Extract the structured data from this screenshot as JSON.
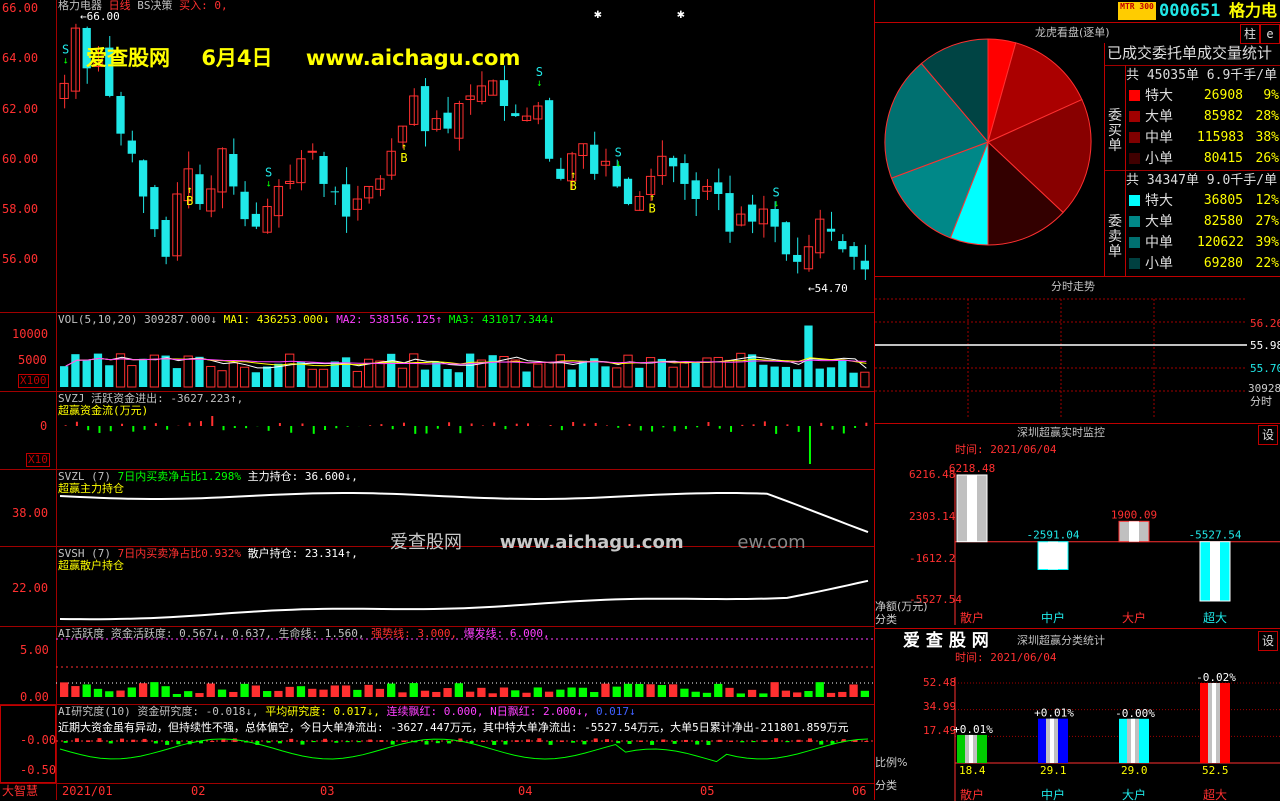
{
  "colors": {
    "up": "#ff3030",
    "down": "#20e8e8",
    "grid": "#a00000",
    "white": "#ffffff",
    "yellow": "#ffff00",
    "magenta": "#ff40ff",
    "green": "#00ff00"
  },
  "main": {
    "header": {
      "name": "格力电器",
      "period": "日线",
      "strategy": "BS决策",
      "buy": "买入: 0,"
    },
    "yaxis": [
      "66.00",
      "64.00",
      "62.00",
      "60.00",
      "58.00",
      "56.00"
    ],
    "max_label": "66.00",
    "min_label": "54.70",
    "watermark": {
      "site": "爱查股网",
      "date": "6月4日",
      "url": "www.aichagu.com"
    }
  },
  "vol": {
    "label": "VOL(5,10,20)",
    "value": "309287.000↓",
    "ma1": "MA1: 436253.000↓",
    "ma2": "MA2: 538156.125↑",
    "ma3": "MA3: 431017.344↓",
    "yaxis": [
      "10000",
      "5000"
    ],
    "unit": "X100"
  },
  "svzj": {
    "label": "SVZJ",
    "desc": "活跃资金进出: -3627.223↑,",
    "sub": "超赢资金流(万元)",
    "yaxis": [
      "0"
    ],
    "unit": "X10"
  },
  "svzl": {
    "label": "SVZL (7)",
    "desc": "7日内买卖净占比1.298%",
    "hold": "主力持仓: 36.600↓,",
    "sub": "超赢主力持仓",
    "yaxis": [
      "38.00"
    ],
    "overlay": {
      "site": "爱查股网",
      "url": "www.aichagu.com",
      "tail": "ew.com"
    }
  },
  "svsh": {
    "label": "SVSH (7)",
    "desc": "7日内买卖净占比0.932%",
    "hold": "散户持仓: 23.314↑,",
    "sub": "超赢散户持仓",
    "yaxis": [
      "22.00"
    ]
  },
  "ai": {
    "label": "AI活跃度",
    "a": "资金活跃度: 0.567↓, 0.637, 生命线: 1.560,",
    "strong": "强势线: 3.000,",
    "burst": "爆发线: 6.000,",
    "yaxis": [
      "5.00",
      "0.00"
    ]
  },
  "air": {
    "label": "AI研究度(10)",
    "a": "资金研究度: -0.018↓,",
    "b": "平均研究度: 0.017↓,",
    "c": "连续飘红: 0.000,",
    "d": "N日飘红: 2.000↓,",
    "e": "0.017↓",
    "note": "近期大资金虽有异动，但持续性不强，总体偏空，今日大单净流出: -3627.447万元，其中特大单净流出: -5527.54万元，大单5日累计净出-211801.859万元",
    "yaxis": [
      "-0.00",
      "-0.50"
    ]
  },
  "xaxis": {
    "app": "大智慧",
    "labels": [
      "2021/01",
      "02",
      "03",
      "04",
      "05",
      "06"
    ]
  },
  "right": {
    "badge": "MTR 300",
    "code": "000651",
    "name": "格力电",
    "btn_zhu": "柱",
    "btn_e": "e",
    "pie": {
      "title": "龙虎看盘(逐单)",
      "header": "已成交委托单成交量统计",
      "buy": {
        "side": "委买单",
        "total": "共 45035单 6.9千手/单",
        "rows": [
          {
            "k": "特大",
            "v": "26908",
            "p": "9%",
            "c": "#ff0000"
          },
          {
            "k": "大单",
            "v": "85982",
            "p": "28%",
            "c": "#a00000"
          },
          {
            "k": "中单",
            "v": "115983",
            "p": "38%",
            "c": "#800000"
          },
          {
            "k": "小单",
            "v": "80415",
            "p": "26%",
            "c": "#400000"
          }
        ]
      },
      "sell": {
        "side": "委卖单",
        "total": "共 34347单 9.0千手/单",
        "rows": [
          {
            "k": "特大",
            "v": "36805",
            "p": "12%",
            "c": "#00ffff"
          },
          {
            "k": "大单",
            "v": "82580",
            "p": "27%",
            "c": "#008888"
          },
          {
            "k": "中单",
            "v": "120622",
            "p": "39%",
            "c": "#007070"
          },
          {
            "k": "小单",
            "v": "69280",
            "p": "22%",
            "c": "#004040"
          }
        ]
      }
    },
    "intraday": {
      "title": "分时走势",
      "labels": [
        "56.26",
        "55.98",
        "55.70",
        "30928"
      ],
      "unit": "分时"
    },
    "monitor": {
      "title": "深圳超赢实时监控",
      "btn": "设",
      "time": "时间: 2021/06/04",
      "yaxis": [
        "6216.48",
        "2303.14",
        "-1612.2",
        "-5527.54"
      ],
      "unit": "净额(万元)",
      "cat_label": "分类",
      "bars": [
        {
          "cat": "散户",
          "value": 6218.48,
          "label": "6218.48"
        },
        {
          "cat": "中户",
          "value": -2591.04,
          "label": "-2591.04"
        },
        {
          "cat": "大户",
          "value": 1900.09,
          "label": "1900.09"
        },
        {
          "cat": "超大",
          "value": -5527.54,
          "label": "-5527.54"
        }
      ]
    },
    "stats": {
      "brand": "爱 查 股 网",
      "title": "深圳超赢分类统计",
      "btn": "设",
      "time": "时间: 2021/06/04",
      "yaxis": [
        "52.48",
        "34.99",
        "17.49"
      ],
      "unit": "比例%",
      "cat_label": "分类",
      "bars": [
        {
          "cat": "散户",
          "value": 18.4,
          "label": "18.4",
          "delta": "+0.01%",
          "color": "#00cc00"
        },
        {
          "cat": "中户",
          "value": 29.1,
          "label": "29.1",
          "delta": "+0.01%",
          "color": "#0000ff"
        },
        {
          "cat": "大户",
          "value": 29.0,
          "label": "29.0",
          "delta": "-0.00%",
          "color": "#00ffff"
        },
        {
          "cat": "超大",
          "value": 52.5,
          "label": "52.5",
          "delta": "-0.02%",
          "color": "#ff0000"
        }
      ]
    }
  },
  "chart_data": [
    {
      "type": "candlestick",
      "title": "格力电器 日线",
      "ylim": [
        54.7,
        66.0
      ],
      "x": [
        "2021/01",
        "02",
        "03",
        "04",
        "05",
        "06"
      ],
      "closes": [
        63.0,
        65.2,
        63.6,
        64.2,
        62.5,
        61.0,
        60.2,
        58.5,
        57.2,
        56.1,
        58.6,
        59.6,
        58.2,
        58.8,
        60.4,
        58.9,
        57.6,
        57.3,
        58.1,
        58.9,
        59.1,
        60.0,
        60.3,
        59.0,
        58.7,
        57.7,
        58.4,
        58.9,
        59.2,
        60.3,
        61.3,
        62.5,
        61.1,
        61.6,
        61.2,
        62.2,
        62.5,
        62.9,
        63.1,
        62.1,
        61.7,
        61.7,
        62.1,
        60.0,
        59.2,
        60.2,
        60.6,
        59.4,
        59.9,
        58.9,
        58.2,
        58.5,
        59.3,
        60.1,
        59.7,
        59.0,
        58.4,
        58.9,
        58.6,
        57.1,
        57.8,
        57.5,
        58.0,
        57.3,
        56.2,
        55.9,
        56.5,
        57.6,
        57.1,
        56.4,
        56.1,
        55.6
      ]
    },
    {
      "type": "bar",
      "title": "VOL(5,10,20)",
      "ylim": [
        0,
        13000
      ],
      "ylabel": "X100"
    },
    {
      "type": "bar",
      "title": "深圳超赢实时监控",
      "categories": [
        "散户",
        "中户",
        "大户",
        "超大"
      ],
      "values": [
        6218.48,
        -2591.04,
        1900.09,
        -5527.54
      ],
      "ylabel": "净额(万元)",
      "ylim": [
        -5527.54,
        6216.48
      ]
    },
    {
      "type": "bar",
      "title": "深圳超赢分类统计",
      "categories": [
        "散户",
        "中户",
        "大户",
        "超大"
      ],
      "values": [
        18.4,
        29.1,
        29.0,
        52.5
      ],
      "ylabel": "比例%",
      "ylim": [
        0,
        52.48
      ]
    },
    {
      "type": "pie",
      "title": "龙虎看盘(逐单)",
      "categories": [
        "委买特大",
        "委买大单",
        "委买中单",
        "委买小单",
        "委卖特大",
        "委卖大单",
        "委卖中单",
        "委卖小单"
      ],
      "values": [
        26908,
        85982,
        115983,
        80415,
        36805,
        82580,
        120622,
        69280
      ]
    }
  ]
}
